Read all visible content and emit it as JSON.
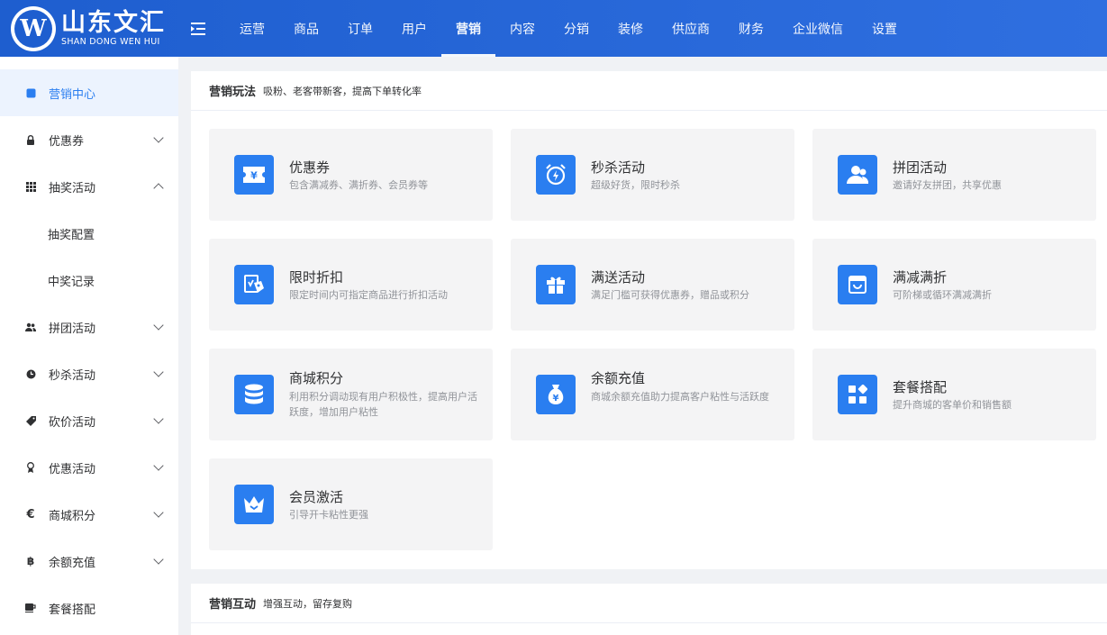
{
  "brand": {
    "logo_letter": "W",
    "name_cn": "山东文汇",
    "name_en": "SHAN DONG WEN HUI"
  },
  "nav": [
    {
      "label": "运营"
    },
    {
      "label": "商品"
    },
    {
      "label": "订单"
    },
    {
      "label": "用户"
    },
    {
      "label": "营销",
      "active": true
    },
    {
      "label": "内容"
    },
    {
      "label": "分销"
    },
    {
      "label": "装修"
    },
    {
      "label": "供应商"
    },
    {
      "label": "财务"
    },
    {
      "label": "企业微信"
    },
    {
      "label": "设置"
    }
  ],
  "sidebar": {
    "items": [
      {
        "label": "营销中心",
        "icon": "square-icon"
      },
      {
        "label": "优惠券",
        "icon": "lock-icon"
      },
      {
        "label": "抽奖活动",
        "icon": "grid-icon"
      },
      {
        "label": "抽奖配置"
      },
      {
        "label": "中奖记录"
      },
      {
        "label": "拼团活动",
        "icon": "users-icon"
      },
      {
        "label": "秒杀活动",
        "icon": "clock-icon"
      },
      {
        "label": "砍价活动",
        "icon": "tag-icon"
      },
      {
        "label": "优惠活动",
        "icon": "medal-icon"
      },
      {
        "label": "商城积分",
        "icon": "euro-icon"
      },
      {
        "label": "余额充值",
        "icon": "bitcoin-icon"
      },
      {
        "label": "套餐搭配",
        "icon": "cup-icon"
      }
    ]
  },
  "section1": {
    "title": "营销玩法",
    "subtitle": "吸粉、老客带新客，提高下单转化率",
    "cards": [
      {
        "title": "优惠券",
        "desc": "包含满减券、满折券、会员券等",
        "icon": "ticket-icon"
      },
      {
        "title": "秒杀活动",
        "desc": "超级好货，限时秒杀",
        "icon": "alarm-icon"
      },
      {
        "title": "拼团活动",
        "desc": "邀请好友拼团，共享优惠",
        "icon": "group-icon"
      },
      {
        "title": "限时折扣",
        "desc": "限定时间内可指定商品进行折扣活动",
        "icon": "discount-tag-icon"
      },
      {
        "title": "满送活动",
        "desc": "满足门槛可获得优惠券，赠品或积分",
        "icon": "gift-icon"
      },
      {
        "title": "满减满折",
        "desc": "可阶梯或循环满减满折",
        "icon": "bag-icon"
      },
      {
        "title": "商城积分",
        "desc": "利用积分调动现有用户积极性，提高用户活跃度，增加用户粘性",
        "icon": "database-icon"
      },
      {
        "title": "余额充值",
        "desc": "商城余额充值助力提高客户粘性与活跃度",
        "icon": "money-bag-icon"
      },
      {
        "title": "套餐搭配",
        "desc": "提升商城的客单价和销售额",
        "icon": "apps-icon"
      },
      {
        "title": "会员激活",
        "desc": "引导开卡粘性更强",
        "icon": "crown-icon"
      }
    ]
  },
  "section2": {
    "title": "营销互动",
    "subtitle": "增强互动，留存复购"
  }
}
